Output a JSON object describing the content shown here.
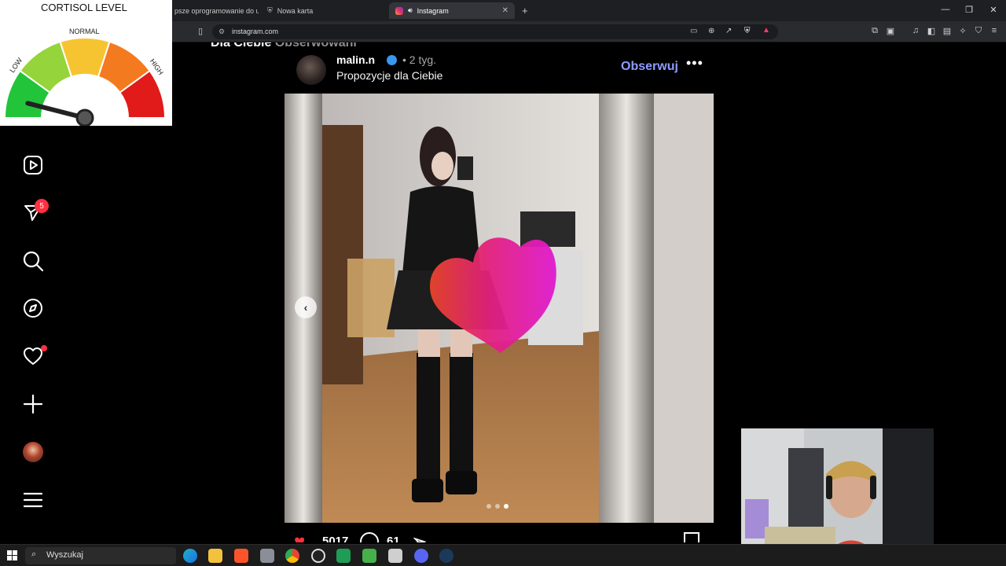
{
  "browser": {
    "tabs": [
      {
        "label": "psze oprogramowanie do u"
      },
      {
        "label": "Nowa karta"
      },
      {
        "label": "Instagram",
        "active": true
      }
    ],
    "new_tab": "+",
    "url": "instagram.com",
    "window_controls": [
      "—",
      "❐",
      "✕"
    ]
  },
  "page": {
    "heading": "Dla Ciebie",
    "heading_alt": "Obserwowani",
    "post": {
      "username": "malin.n",
      "time_ago": "• 2 tyg.",
      "suggestion": "Propozycje dla Ciebie",
      "follow_label": "Obserwuj",
      "more_label": "•••",
      "likes": "5017",
      "comments": "61",
      "carousel_count": 3,
      "carousel_active": 3
    }
  },
  "sidebar": {
    "reels_badge": "5"
  },
  "overlay": {
    "title": "CORTISOL LEVEL",
    "normal": "NORMAL",
    "low": "LOW",
    "high": "HIGH",
    "level": 0.08
  },
  "taskbar": {
    "search_placeholder": "Wyszukaj"
  },
  "colors": {
    "accent_follow": "#8e9cff",
    "badge": "#ff3040",
    "gauge": [
      "#22c43a",
      "#95d43a",
      "#f7c431",
      "#f47a1f",
      "#e11a1a"
    ]
  }
}
